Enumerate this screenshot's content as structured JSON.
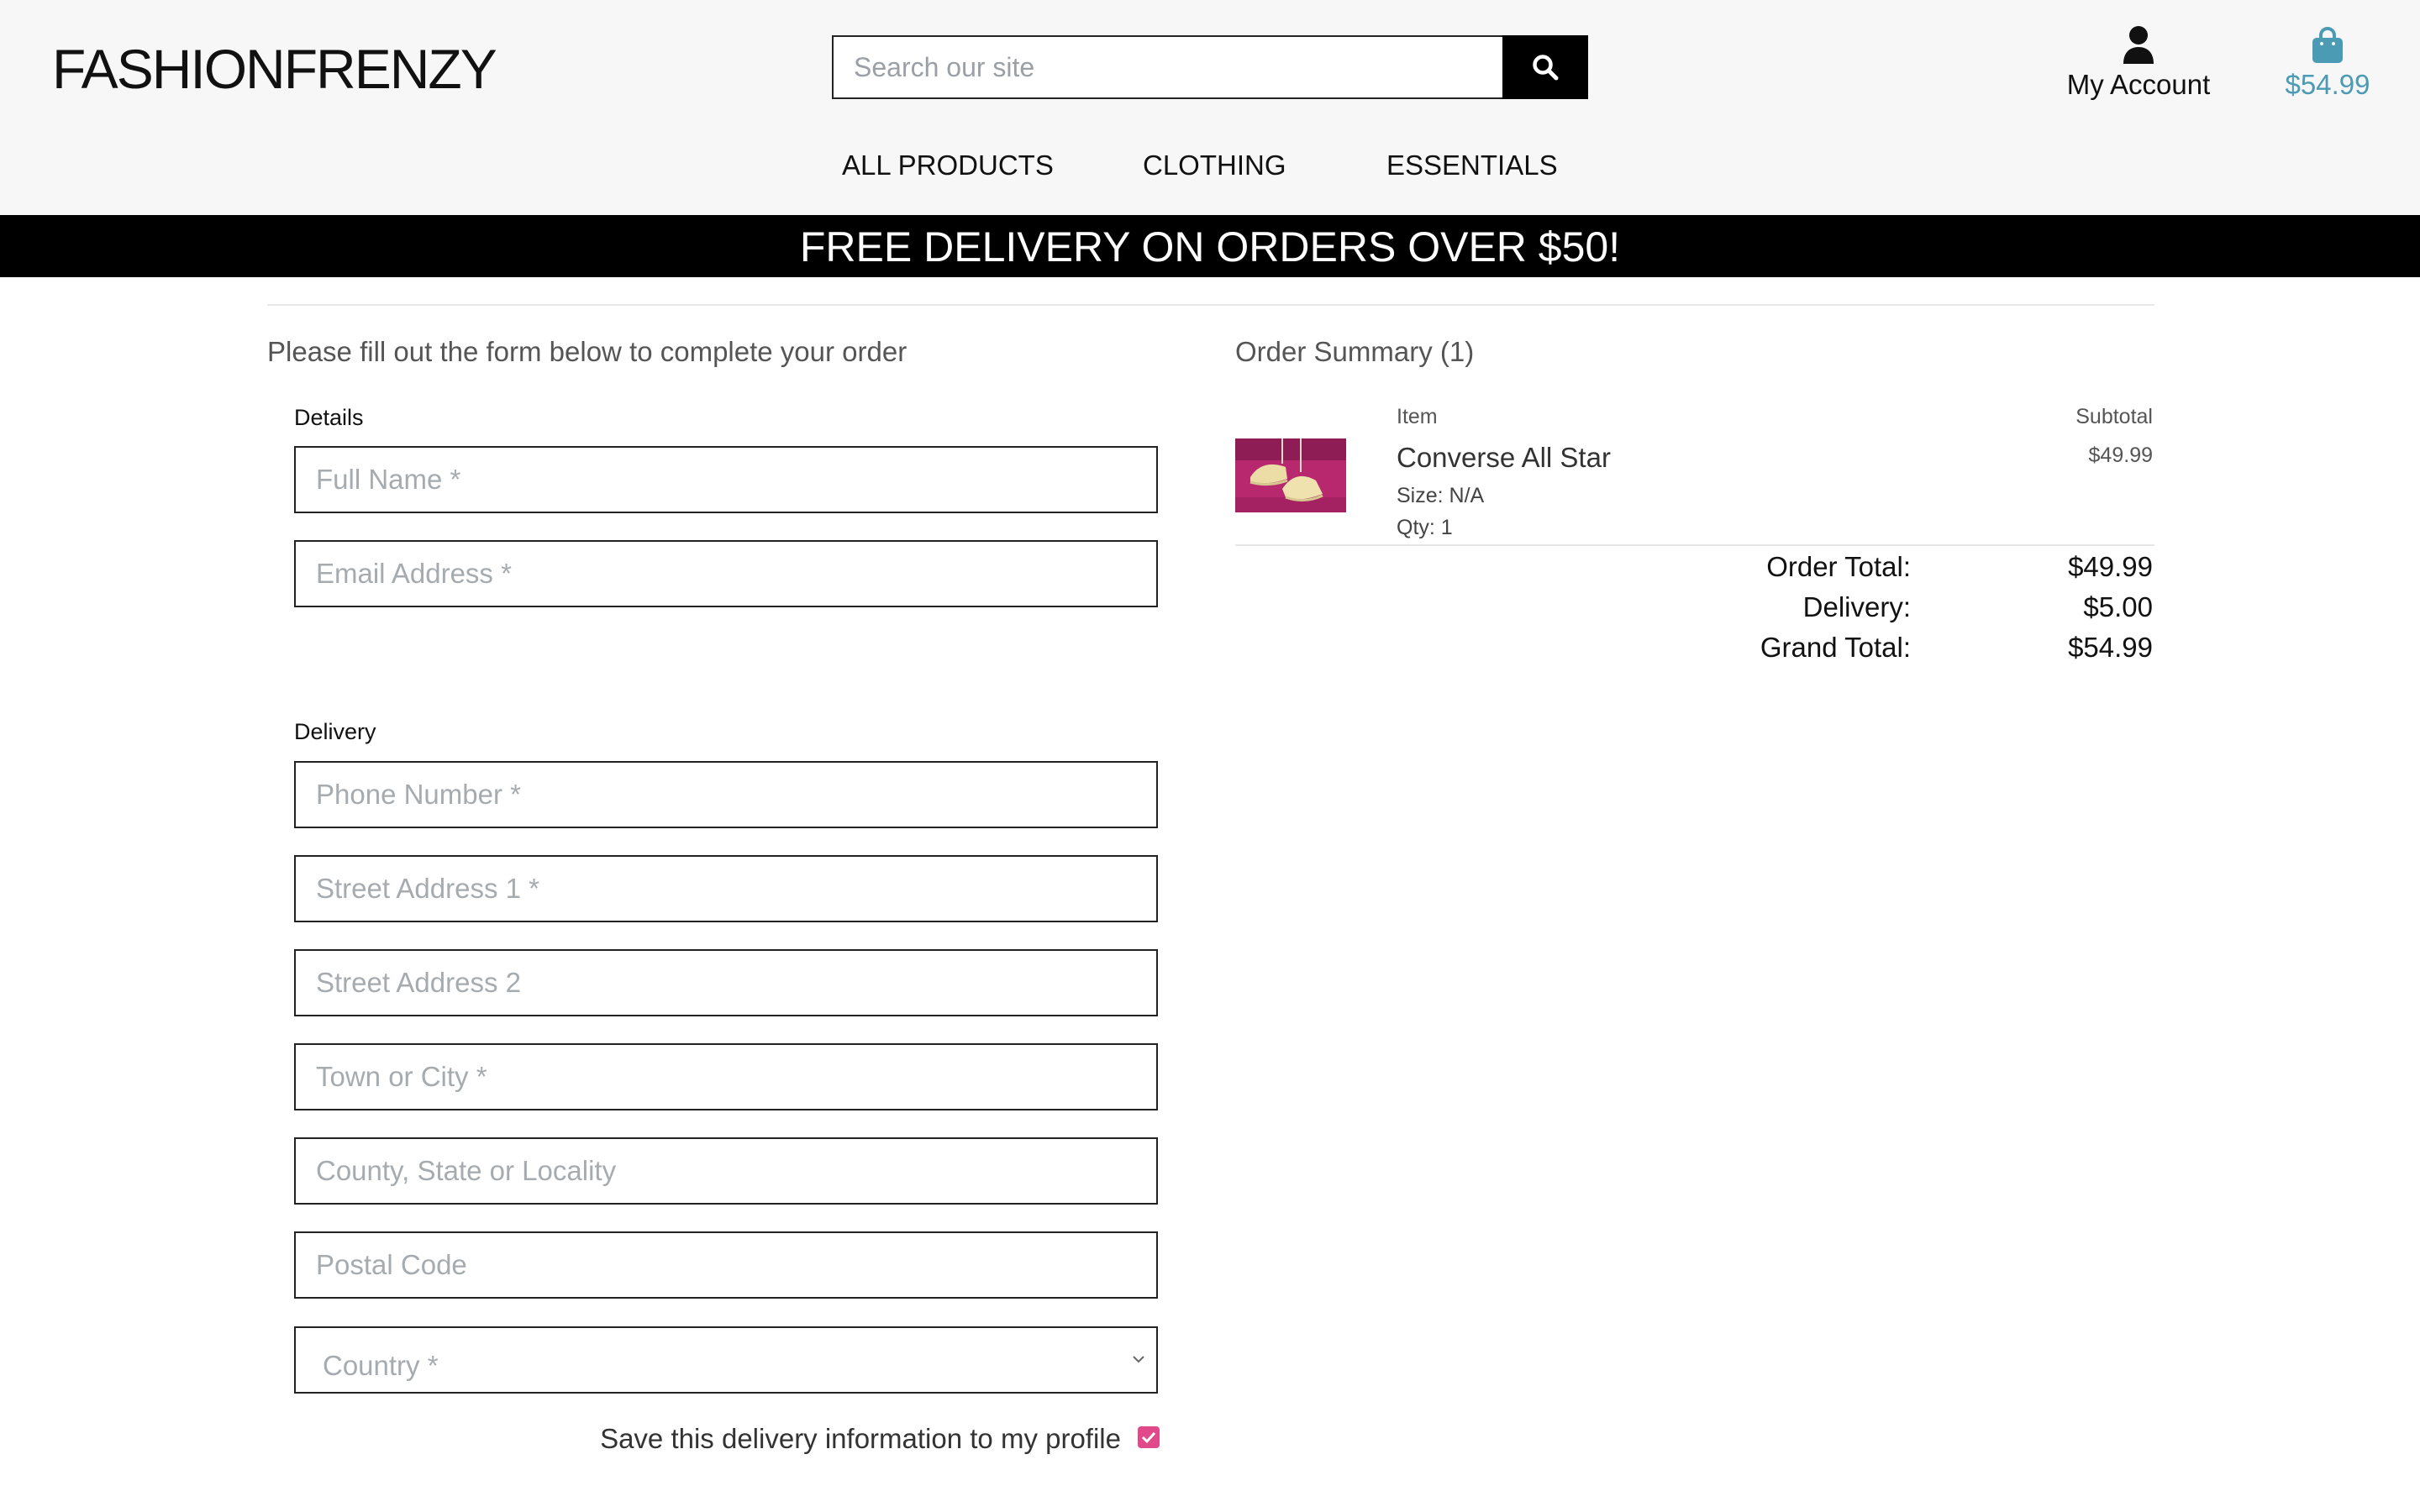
{
  "header": {
    "brand": "FASHIONFRENZY",
    "search_placeholder": "Search our site",
    "account_label": "My Account",
    "bag_total": "$54.99",
    "nav": [
      "ALL PRODUCTS",
      "CLOTHING",
      "ESSENTIALS"
    ]
  },
  "banner": "FREE DELIVERY ON ORDERS OVER $50!",
  "form": {
    "intro": "Please fill out the form below to complete your order",
    "details_label": "Details",
    "full_name_placeholder": "Full Name *",
    "email_placeholder": "Email Address *",
    "delivery_label": "Delivery",
    "phone_placeholder": "Phone Number *",
    "street1_placeholder": "Street Address 1 *",
    "street2_placeholder": "Street Address 2",
    "town_placeholder": "Town or City *",
    "county_placeholder": "County, State or Locality",
    "postcode_placeholder": "Postal Code",
    "country_selected": "Country *",
    "save_info_label": "Save this delivery information to my profile",
    "save_info_checked": true
  },
  "summary": {
    "title": "Order Summary (1)",
    "item_header": "Item",
    "subtotal_header": "Subtotal",
    "item": {
      "name": "Converse All Star",
      "size": "Size: N/A",
      "qty": "Qty: 1",
      "subtotal": "$49.99"
    },
    "order_total_label": "Order Total:",
    "order_total": "$49.99",
    "delivery_label": "Delivery:",
    "delivery": "$5.00",
    "grand_total_label": "Grand Total:",
    "grand_total": "$54.99"
  },
  "colors": {
    "accent": "#4a9bb3",
    "checkbox": "#e0498a",
    "banner_bg": "#000000"
  }
}
